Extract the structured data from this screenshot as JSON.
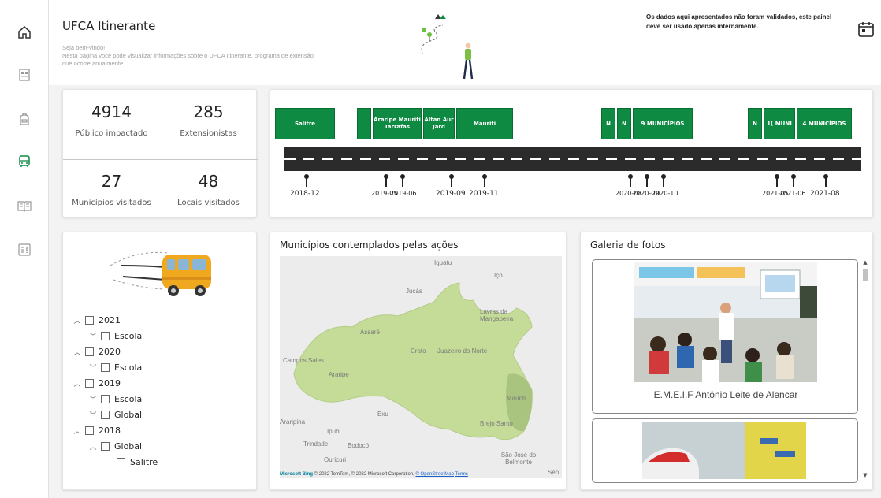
{
  "header": {
    "title": "UFCA Itinerante",
    "welcome_line1": "Seja bem-vindo!",
    "welcome_line2": "Nesta página você pode visualizar informações sobre o UFCA Itinerante, programa de extensão que ocorre anualmente.",
    "disclaimer": "Os dados aqui apresentados não foram validados, este painel deve ser usado apenas internamente."
  },
  "kpis": [
    {
      "value": "4914",
      "label": "Público impactado"
    },
    {
      "value": "285",
      "label": "Extensionistas"
    },
    {
      "value": "27",
      "label": "Municípios visitados"
    },
    {
      "value": "48",
      "label": "Locais visitados"
    }
  ],
  "timeline": {
    "boxes": [
      {
        "text": "Salitre"
      },
      {
        "text": ""
      },
      {
        "text": "Araripe Mauriti Tarrafas"
      },
      {
        "text": "Altan Aur Jard"
      },
      {
        "text": "Mauriti"
      },
      {
        "text": "N"
      },
      {
        "text": "N"
      },
      {
        "text": "9 MUNICÍPIOS"
      },
      {
        "text": "N"
      },
      {
        "text": "1( MUNI"
      },
      {
        "text": "4 MUNICÍPIOS"
      }
    ],
    "dates": [
      "2018-12",
      "2019-05",
      "2019-06",
      "2019-09",
      "2019-11",
      "2020-08",
      "2020-09",
      "2020-10",
      "2021-05",
      "2021-06",
      "2021-08"
    ]
  },
  "filter": {
    "rows": [
      {
        "label": "2021",
        "chevron": "up"
      },
      {
        "label": "Escola",
        "chevron": "down"
      },
      {
        "label": "2020",
        "chevron": "up"
      },
      {
        "label": "Escola",
        "chevron": "down"
      },
      {
        "label": "2019",
        "chevron": "up"
      },
      {
        "label": "Escola",
        "chevron": "down"
      },
      {
        "label": "Global",
        "chevron": "down"
      },
      {
        "label": "2018",
        "chevron": "up"
      },
      {
        "label": "Global",
        "chevron": "up"
      },
      {
        "label": "Salitre",
        "chevron": ""
      }
    ]
  },
  "map": {
    "title": "Municípios contemplados pelas ações",
    "labels": [
      "Iguatu",
      "Jucás",
      "Lavras da Mangabeira",
      "Assaré",
      "Campos Sales",
      "Araripe",
      "Crato",
      "Juazeiro do Norte",
      "Mauriti",
      "Brejo Santo",
      "Exu",
      "Araripina",
      "Ipubi",
      "Trindade",
      "Bodocó",
      "Ouricuri",
      "São José do Belmonte",
      "Iço",
      "Sen"
    ],
    "bing": "Microsoft Bing",
    "attribution": "© 2022 TomTom, © 2022 Microsoft Corporation,",
    "osm": "© OpenStreetMap",
    "terms": "Terms",
    "region_color": "#c5dc99",
    "highlight_color": "#a9c47e"
  },
  "gallery": {
    "title": "Galeria de fotos",
    "items": [
      {
        "caption": "E.M.E.I.F Antônio Leite de Alencar"
      }
    ]
  },
  "colors": {
    "accent_green": "#0f8a42",
    "road": "#2b2b2b"
  },
  "icons": [
    "home-icon",
    "report-icon",
    "backpack-icon",
    "bus-icon",
    "book-icon",
    "list-icon",
    "calendar-icon"
  ]
}
